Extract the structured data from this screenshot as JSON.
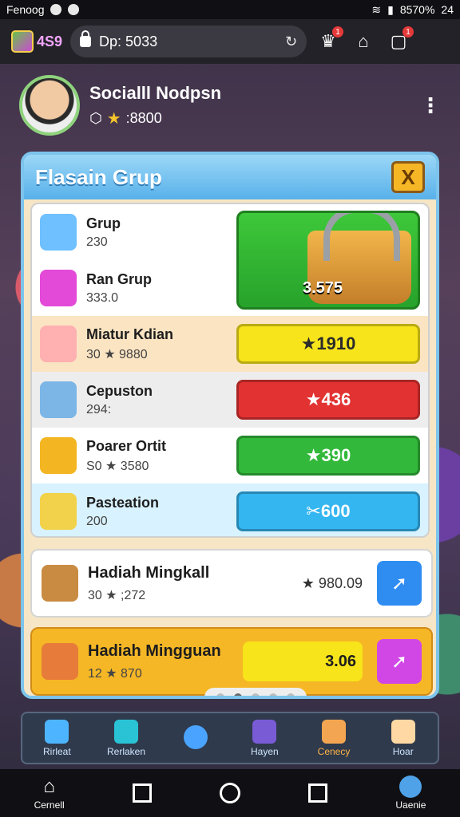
{
  "status": {
    "left": "Fenoog",
    "right_battery": "8570%",
    "right_time": "24"
  },
  "top": {
    "gift_count": "4S9",
    "url": "Dp: 5033"
  },
  "profile": {
    "name": "Socialll Nodpsn",
    "score": ":8800"
  },
  "panel": {
    "title": "Flasain Grup",
    "close": "X",
    "rows": [
      {
        "name": "Grup",
        "meta": "230",
        "btn": ""
      },
      {
        "name": "Ran Grup",
        "meta": "333.0",
        "btn": ""
      },
      {
        "name": "Miatur Kdian",
        "meta": "30 ★ 9880",
        "btn": "★1910"
      },
      {
        "name": "Cepuston",
        "meta": "294:",
        "btn": "★436"
      },
      {
        "name": "Poarer Ortit",
        "meta": "S0 ★ 3580",
        "btn": "★390"
      },
      {
        "name": "Pasteation",
        "meta": "200",
        "btn": "✂600"
      }
    ],
    "featured_value": "3.575",
    "card1": {
      "name": "Hadiah Mingkall",
      "meta": "30 ★ ;272",
      "value": "★ 980.09"
    },
    "card2": {
      "name": "Hadiah Mingguan",
      "meta": "12 ★ 870",
      "value": "3.06"
    }
  },
  "tabs": [
    {
      "label": "Rirleat"
    },
    {
      "label": "Rerlaken"
    },
    {
      "label": ""
    },
    {
      "label": "Hayen"
    },
    {
      "label": "Cenecy"
    },
    {
      "label": "Hoar"
    }
  ],
  "nav": {
    "left": "Cernell",
    "right": "Uaenie"
  },
  "colors": {
    "green": "#32b83a",
    "yellow": "#f7e41a",
    "red": "#e23232",
    "cyan": "#34b6f0",
    "purple": "#d047e6",
    "blue": "#2f8df2"
  }
}
